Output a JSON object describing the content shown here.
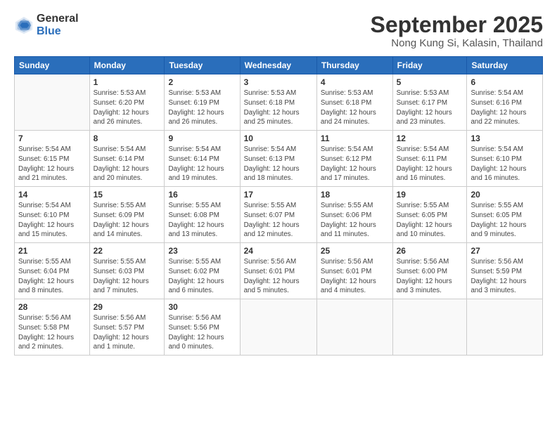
{
  "header": {
    "logo_general": "General",
    "logo_blue": "Blue",
    "month_title": "September 2025",
    "subtitle": "Nong Kung Si, Kalasin, Thailand"
  },
  "weekdays": [
    "Sunday",
    "Monday",
    "Tuesday",
    "Wednesday",
    "Thursday",
    "Friday",
    "Saturday"
  ],
  "weeks": [
    [
      {
        "day": "",
        "info": ""
      },
      {
        "day": "1",
        "info": "Sunrise: 5:53 AM\nSunset: 6:20 PM\nDaylight: 12 hours\nand 26 minutes."
      },
      {
        "day": "2",
        "info": "Sunrise: 5:53 AM\nSunset: 6:19 PM\nDaylight: 12 hours\nand 26 minutes."
      },
      {
        "day": "3",
        "info": "Sunrise: 5:53 AM\nSunset: 6:18 PM\nDaylight: 12 hours\nand 25 minutes."
      },
      {
        "day": "4",
        "info": "Sunrise: 5:53 AM\nSunset: 6:18 PM\nDaylight: 12 hours\nand 24 minutes."
      },
      {
        "day": "5",
        "info": "Sunrise: 5:53 AM\nSunset: 6:17 PM\nDaylight: 12 hours\nand 23 minutes."
      },
      {
        "day": "6",
        "info": "Sunrise: 5:54 AM\nSunset: 6:16 PM\nDaylight: 12 hours\nand 22 minutes."
      }
    ],
    [
      {
        "day": "7",
        "info": "Sunrise: 5:54 AM\nSunset: 6:15 PM\nDaylight: 12 hours\nand 21 minutes."
      },
      {
        "day": "8",
        "info": "Sunrise: 5:54 AM\nSunset: 6:14 PM\nDaylight: 12 hours\nand 20 minutes."
      },
      {
        "day": "9",
        "info": "Sunrise: 5:54 AM\nSunset: 6:14 PM\nDaylight: 12 hours\nand 19 minutes."
      },
      {
        "day": "10",
        "info": "Sunrise: 5:54 AM\nSunset: 6:13 PM\nDaylight: 12 hours\nand 18 minutes."
      },
      {
        "day": "11",
        "info": "Sunrise: 5:54 AM\nSunset: 6:12 PM\nDaylight: 12 hours\nand 17 minutes."
      },
      {
        "day": "12",
        "info": "Sunrise: 5:54 AM\nSunset: 6:11 PM\nDaylight: 12 hours\nand 16 minutes."
      },
      {
        "day": "13",
        "info": "Sunrise: 5:54 AM\nSunset: 6:10 PM\nDaylight: 12 hours\nand 16 minutes."
      }
    ],
    [
      {
        "day": "14",
        "info": "Sunrise: 5:54 AM\nSunset: 6:10 PM\nDaylight: 12 hours\nand 15 minutes."
      },
      {
        "day": "15",
        "info": "Sunrise: 5:55 AM\nSunset: 6:09 PM\nDaylight: 12 hours\nand 14 minutes."
      },
      {
        "day": "16",
        "info": "Sunrise: 5:55 AM\nSunset: 6:08 PM\nDaylight: 12 hours\nand 13 minutes."
      },
      {
        "day": "17",
        "info": "Sunrise: 5:55 AM\nSunset: 6:07 PM\nDaylight: 12 hours\nand 12 minutes."
      },
      {
        "day": "18",
        "info": "Sunrise: 5:55 AM\nSunset: 6:06 PM\nDaylight: 12 hours\nand 11 minutes."
      },
      {
        "day": "19",
        "info": "Sunrise: 5:55 AM\nSunset: 6:05 PM\nDaylight: 12 hours\nand 10 minutes."
      },
      {
        "day": "20",
        "info": "Sunrise: 5:55 AM\nSunset: 6:05 PM\nDaylight: 12 hours\nand 9 minutes."
      }
    ],
    [
      {
        "day": "21",
        "info": "Sunrise: 5:55 AM\nSunset: 6:04 PM\nDaylight: 12 hours\nand 8 minutes."
      },
      {
        "day": "22",
        "info": "Sunrise: 5:55 AM\nSunset: 6:03 PM\nDaylight: 12 hours\nand 7 minutes."
      },
      {
        "day": "23",
        "info": "Sunrise: 5:55 AM\nSunset: 6:02 PM\nDaylight: 12 hours\nand 6 minutes."
      },
      {
        "day": "24",
        "info": "Sunrise: 5:56 AM\nSunset: 6:01 PM\nDaylight: 12 hours\nand 5 minutes."
      },
      {
        "day": "25",
        "info": "Sunrise: 5:56 AM\nSunset: 6:01 PM\nDaylight: 12 hours\nand 4 minutes."
      },
      {
        "day": "26",
        "info": "Sunrise: 5:56 AM\nSunset: 6:00 PM\nDaylight: 12 hours\nand 3 minutes."
      },
      {
        "day": "27",
        "info": "Sunrise: 5:56 AM\nSunset: 5:59 PM\nDaylight: 12 hours\nand 3 minutes."
      }
    ],
    [
      {
        "day": "28",
        "info": "Sunrise: 5:56 AM\nSunset: 5:58 PM\nDaylight: 12 hours\nand 2 minutes."
      },
      {
        "day": "29",
        "info": "Sunrise: 5:56 AM\nSunset: 5:57 PM\nDaylight: 12 hours\nand 1 minute."
      },
      {
        "day": "30",
        "info": "Sunrise: 5:56 AM\nSunset: 5:56 PM\nDaylight: 12 hours\nand 0 minutes."
      },
      {
        "day": "",
        "info": ""
      },
      {
        "day": "",
        "info": ""
      },
      {
        "day": "",
        "info": ""
      },
      {
        "day": "",
        "info": ""
      }
    ]
  ]
}
